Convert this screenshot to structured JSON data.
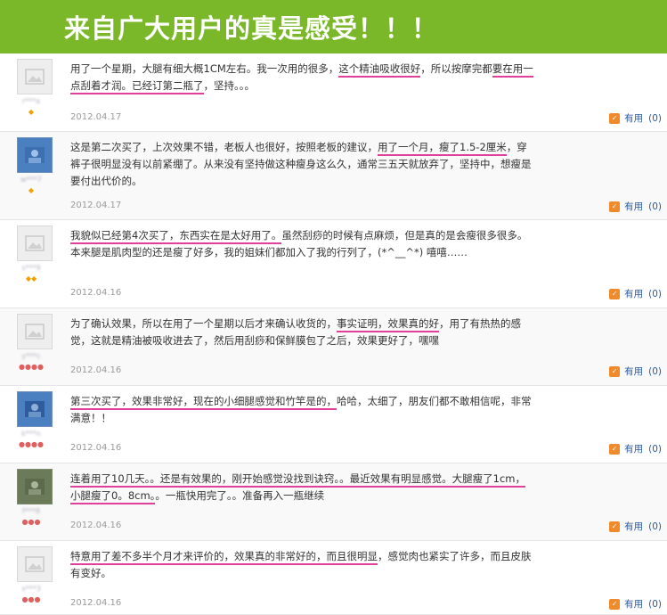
{
  "banner": {
    "title": "来自广大用户的真是感受！！！"
  },
  "useful_label": "有用",
  "reviews": [
    {
      "user": "r***a",
      "segments": [
        {
          "text": "用了一个星期，大腿有细大概1CM左右。我一次用的很多，",
          "hl": false
        },
        {
          "text": "这个精油吸收很好",
          "hl": true
        },
        {
          "text": "，所以按摩完都",
          "hl": false
        },
        {
          "text": "要在用一点刮着才润。已经订第二瓶了",
          "hl": true
        },
        {
          "text": "，坚持。。。",
          "hl": false
        }
      ],
      "date": "2012.04.17",
      "useful_count": "(0)"
    },
    {
      "user": "w***7",
      "segments": [
        {
          "text": "这是第二次买了，上次效果不错，老板人也很好，按照老板的建议，",
          "hl": false
        },
        {
          "text": "用了一个月，瘦了1.5-2厘米",
          "hl": true
        },
        {
          "text": "，穿裤子很明显没有以前紧绷了。从来没有坚持做这种瘦身这么久，通常三五天就放弃了，坚持中，想瘦是要付出代价的。",
          "hl": false
        }
      ],
      "date": "2012.04.17",
      "useful_count": "(0)"
    },
    {
      "user": "s***9",
      "segments": [
        {
          "text": "我貌似已经第4次买了，东西实在是太好用了。",
          "hl": true
        },
        {
          "text": "虽然刮痧的时候有点麻烦，但是真的是会瘦很多很多。本来腿是肌肉型的还是瘦了好多，我的姐妹们都加入了我的行列了，(*^__^*) 嘻嘻……",
          "hl": false
        }
      ],
      "date": "2012.04.16",
      "useful_count": "(0)"
    },
    {
      "user": "y***c",
      "segments": [
        {
          "text": "为了确认效果，所以在用了一个星期以后才来确认收货的，",
          "hl": false
        },
        {
          "text": "事实证明，效果真的好",
          "hl": true
        },
        {
          "text": "，用了有热热的感觉，这就是精油被吸收进去了，然后用刮痧和保鲜膜包了之后，效果更好了，嘿嘿",
          "hl": false
        }
      ],
      "date": "2012.04.16",
      "useful_count": "(0)"
    },
    {
      "user": "k***n",
      "segments": [
        {
          "text": "第三次买了，效果非常好，现在的小细腿感觉和竹竿是的，",
          "hl": true
        },
        {
          "text": "哈哈，太细了，朋友们都不敢相信呢，非常满意！！",
          "hl": false
        }
      ],
      "date": "2012.04.16",
      "useful_count": "(0)"
    },
    {
      "user": "f***8",
      "segments": [
        {
          "text": "连着用了10几天。。还是有效果的，刚开始感觉没找到诀窍。。最近效果有明显感觉。大腿瘦了1cm，小腿瘦了0。8cm。",
          "hl": true
        },
        {
          "text": "。一瓶快用完了。。准备再入一瓶继续",
          "hl": false
        }
      ],
      "date": "2012.04.16",
      "useful_count": "(0)"
    },
    {
      "user": "x***3",
      "segments": [
        {
          "text": "特意用了差不多半个月才来评价的，效果真的非常好的，而且很明显",
          "hl": true
        },
        {
          "text": "，感觉肉也紧实了许多，而且皮肤有变好。",
          "hl": false
        }
      ],
      "date": "2012.04.16",
      "useful_count": "(0)"
    }
  ]
}
